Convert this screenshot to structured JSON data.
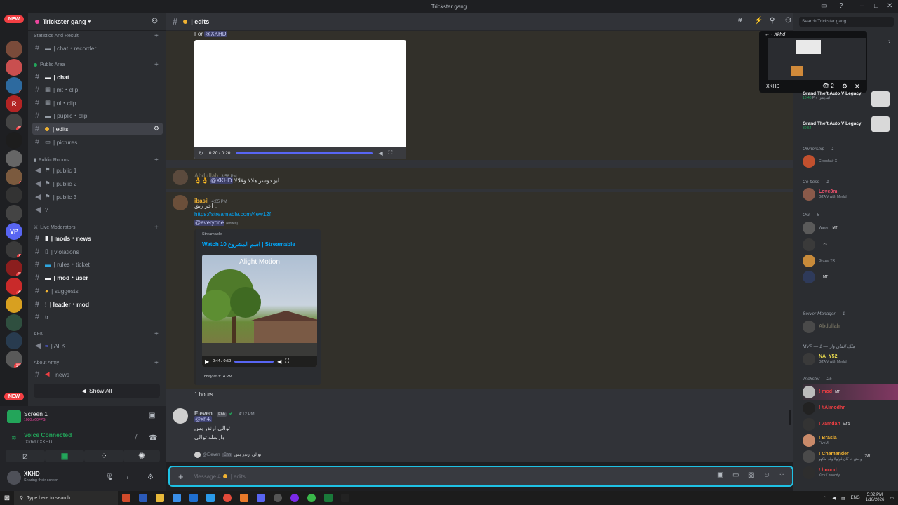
{
  "window": {
    "title": "Trickster gang"
  },
  "search": {
    "placeholder": "Search Trickster gang"
  },
  "channel_header": {
    "name": "| edits"
  },
  "server_rail": {
    "new_label": "NEW",
    "badges": [
      "3",
      "3",
      "33",
      "3",
      "11",
      "32",
      "48",
      "113"
    ]
  },
  "sidebar": {
    "guild_name": "Trickster gang",
    "categories": [
      {
        "name": "Statistics And Result"
      },
      {
        "name": "Public Area"
      },
      {
        "name": "Public Rooms"
      },
      {
        "name": "Live Moderators"
      },
      {
        "name": "AFK"
      },
      {
        "name": "About Army"
      }
    ],
    "channels": [
      {
        "label": "| chat・recorder"
      },
      {
        "label": "| chat"
      },
      {
        "label": "| mt・clip"
      },
      {
        "label": "| ol・clip"
      },
      {
        "label": "| puplic・clip"
      },
      {
        "label": "| edits"
      },
      {
        "label": "| pictures"
      },
      {
        "label": "| public 1"
      },
      {
        "label": "| public 2"
      },
      {
        "label": "| public 3"
      },
      {
        "label": "?"
      },
      {
        "label": "| mods・news"
      },
      {
        "label": "| violations"
      },
      {
        "label": "| rules・ticket"
      },
      {
        "label": "| mod・user"
      },
      {
        "label": "| suggests"
      },
      {
        "label": "| leader・mod"
      },
      {
        "label": "tr"
      },
      {
        "label": "| AFK"
      },
      {
        "label": "| news"
      }
    ],
    "show_all": "Show All"
  },
  "voice": {
    "screen_title": "Screen 1",
    "screen_sub": "1080p 60FPS",
    "status": "Voice Connected",
    "location": "Xkhd / XKHD",
    "user": "XKHD",
    "user_status": "Sharing their screen"
  },
  "messages": {
    "m0": {
      "prefix": "For",
      "mention": "@XKHD",
      "video_time": "0:20 / 0:20"
    },
    "m1": {
      "user": "Abdullah",
      "time": "3:58 PM",
      "mention": "@XKHD",
      "text": "ابو دوسر هلالا وقلالا"
    },
    "m2": {
      "user": "ibasil",
      "time": "4:05 PM",
      "text": "اخر ربق ..",
      "link": "https://streamable.com/4ew12f",
      "everyone": "@everyone",
      "edited": "(edited)",
      "embed_provider": "Streamable",
      "embed_title": "Watch 10 اسم المشروع | Streamable",
      "embed_watermark": "Alight Motion",
      "embed_time": "0:44 / 0:50",
      "embed_footer": "Today at 3:14 PM"
    },
    "divider": "1 hours",
    "m3": {
      "user": "Eleven",
      "tag": "Ehh",
      "time": "4:12 PM",
      "mention": "@xh4.",
      "lines": [
        "توالي ارندر بس",
        "وارسله توالي"
      ],
      "reply_user": "@Eleven",
      "reply_tag": "Ehh",
      "reply_text": "توالي ارندر بس"
    }
  },
  "input": {
    "placeholder": "Message #",
    "channel": "| edits"
  },
  "stream_preview": {
    "title": "Xkhd",
    "user": "XKHD",
    "viewers": "2"
  },
  "activities": [
    {
      "game": "Grand Theft Auto V Legacy",
      "sub": "10:40",
      "extra": "Prv لمدينش"
    },
    {
      "game": "Grand Theft Auto V Legacy",
      "sub": "30:54"
    }
  ],
  "member_groups": [
    {
      "title": "Ownership — 1"
    },
    {
      "title": "Co boss — 1"
    },
    {
      "title": "OG — 5"
    },
    {
      "title": "Server Manager — 1"
    },
    {
      "title": "MVP — ملك الفاي وار — 1"
    },
    {
      "title": "Trickster — 25"
    }
  ],
  "members": [
    {
      "name": "",
      "status": "Crosshair X"
    },
    {
      "name": "Love3m",
      "status": "GTA V with Medal"
    },
    {
      "name": "",
      "status": "Wasly",
      "tag": "MT"
    },
    {
      "name": "",
      "status": "",
      "tag": "23"
    },
    {
      "name": "",
      "status": "Groza_TR"
    },
    {
      "name": "",
      "status": "",
      "tag": "MT"
    },
    {
      "name": "Abdullah",
      "status": ""
    },
    {
      "name": "NA_Y52",
      "status": "GTA V with Medal"
    },
    {
      "name": "! mod",
      "status": "",
      "tag": "MT"
    },
    {
      "name": "! #Almodhr",
      "status": ""
    },
    {
      "name": "! 7amdan",
      "status": "",
      "tag": "iaF1"
    },
    {
      "name": "! Brasla",
      "status": "FiveM"
    },
    {
      "name": "! Chamander",
      "status": "وحش انا كان قولولا وقد ماكهو",
      "tag": "7W"
    },
    {
      "name": "! hnood",
      "status": "Kick / hnoody"
    }
  ],
  "taskbar": {
    "search": "Type here to search",
    "time": "5:02 PM",
    "date": "1/18/2026",
    "lang": "ENG"
  }
}
